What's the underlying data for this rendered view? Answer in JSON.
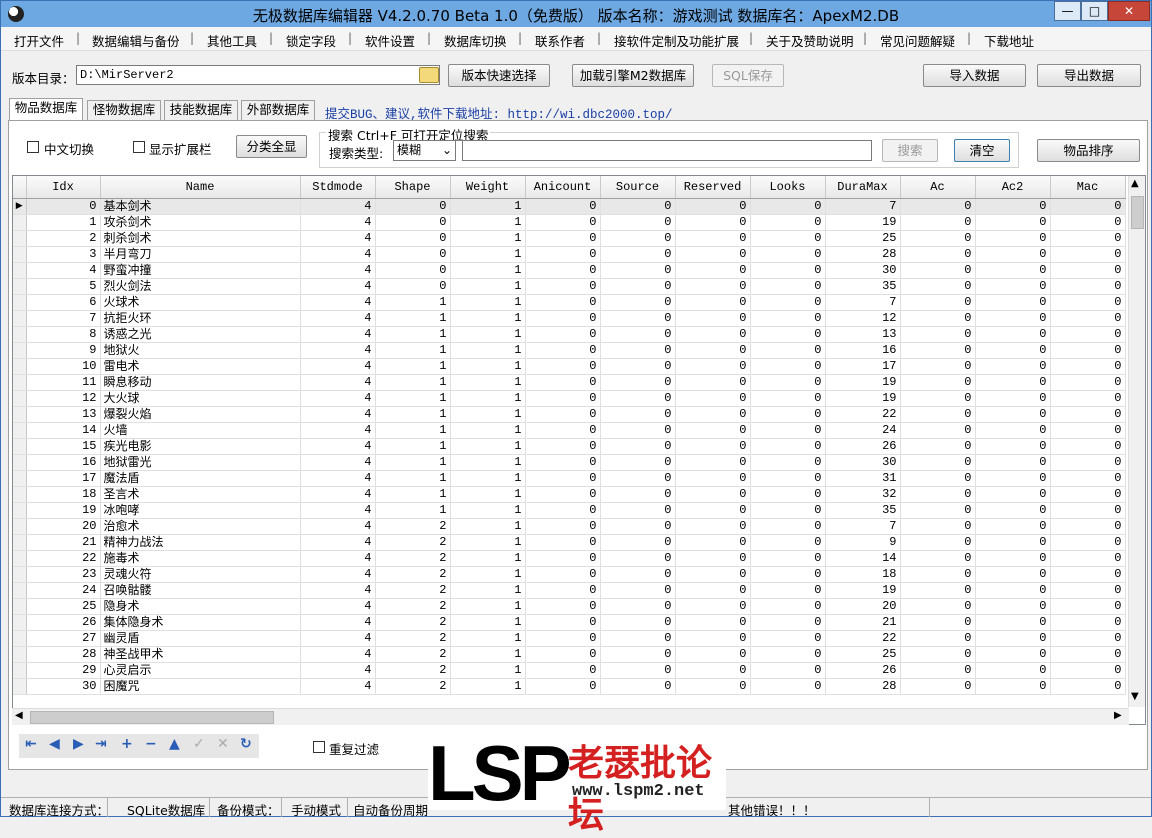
{
  "window": {
    "title": "无极数据库编辑器 V4.2.0.70   Beta 1.0（免费版）   版本名称：游戏测试    数据库名：ApexM2.DB",
    "minimize": "—",
    "maximize": "□",
    "close": "✕"
  },
  "menu": [
    "打开文件",
    "数据编辑与备份",
    "其他工具",
    "锁定字段",
    "软件设置",
    "数据库切换",
    "联系作者",
    "接软件定制及功能扩展",
    "关于及赞助说明",
    "常见问题解疑",
    "下载地址"
  ],
  "toolbar": {
    "dir_label": "版本目录：",
    "dir_value": "D:\\MirServer2",
    "quick_select": "版本快速选择",
    "load_engine": "加载引擎M2数据库",
    "sql_save": "SQL保存",
    "import": "导入数据",
    "export": "导出数据"
  },
  "tabs": [
    "物品数据库",
    "怪物数据库",
    "技能数据库",
    "外部数据库"
  ],
  "bug_link": "提交BUG、建议,软件下载地址: http://wi.dbc2000.top/",
  "search": {
    "cn_switch": "中文切换",
    "show_ext": "显示扩展栏",
    "cat_all": "分类全显",
    "hint": "搜索  Ctrl+F 可打开定位搜索",
    "type_label": "搜索类型:",
    "type_value": "模糊",
    "search_btn": "搜索",
    "clear_btn": "清空",
    "sort_btn": "物品排序"
  },
  "grid": {
    "columns": [
      "Idx",
      "Name",
      "Stdmode",
      "Shape",
      "Weight",
      "Anicount",
      "Source",
      "Reserved",
      "Looks",
      "DuraMax",
      "Ac",
      "Ac2",
      "Mac"
    ],
    "rows": [
      [
        0,
        "基本剑术",
        4,
        0,
        1,
        0,
        0,
        0,
        0,
        7,
        0,
        0,
        0
      ],
      [
        1,
        "攻杀剑术",
        4,
        0,
        1,
        0,
        0,
        0,
        0,
        19,
        0,
        0,
        0
      ],
      [
        2,
        "刺杀剑术",
        4,
        0,
        1,
        0,
        0,
        0,
        0,
        25,
        0,
        0,
        0
      ],
      [
        3,
        "半月弯刀",
        4,
        0,
        1,
        0,
        0,
        0,
        0,
        28,
        0,
        0,
        0
      ],
      [
        4,
        "野蛮冲撞",
        4,
        0,
        1,
        0,
        0,
        0,
        0,
        30,
        0,
        0,
        0
      ],
      [
        5,
        "烈火剑法",
        4,
        0,
        1,
        0,
        0,
        0,
        0,
        35,
        0,
        0,
        0
      ],
      [
        6,
        "火球术",
        4,
        1,
        1,
        0,
        0,
        0,
        0,
        7,
        0,
        0,
        0
      ],
      [
        7,
        "抗拒火环",
        4,
        1,
        1,
        0,
        0,
        0,
        0,
        12,
        0,
        0,
        0
      ],
      [
        8,
        "诱惑之光",
        4,
        1,
        1,
        0,
        0,
        0,
        0,
        13,
        0,
        0,
        0
      ],
      [
        9,
        "地狱火",
        4,
        1,
        1,
        0,
        0,
        0,
        0,
        16,
        0,
        0,
        0
      ],
      [
        10,
        "雷电术",
        4,
        1,
        1,
        0,
        0,
        0,
        0,
        17,
        0,
        0,
        0
      ],
      [
        11,
        "瞬息移动",
        4,
        1,
        1,
        0,
        0,
        0,
        0,
        19,
        0,
        0,
        0
      ],
      [
        12,
        "大火球",
        4,
        1,
        1,
        0,
        0,
        0,
        0,
        19,
        0,
        0,
        0
      ],
      [
        13,
        "爆裂火焰",
        4,
        1,
        1,
        0,
        0,
        0,
        0,
        22,
        0,
        0,
        0
      ],
      [
        14,
        "火墙",
        4,
        1,
        1,
        0,
        0,
        0,
        0,
        24,
        0,
        0,
        0
      ],
      [
        15,
        "疾光电影",
        4,
        1,
        1,
        0,
        0,
        0,
        0,
        26,
        0,
        0,
        0
      ],
      [
        16,
        "地狱雷光",
        4,
        1,
        1,
        0,
        0,
        0,
        0,
        30,
        0,
        0,
        0
      ],
      [
        17,
        "魔法盾",
        4,
        1,
        1,
        0,
        0,
        0,
        0,
        31,
        0,
        0,
        0
      ],
      [
        18,
        "圣言术",
        4,
        1,
        1,
        0,
        0,
        0,
        0,
        32,
        0,
        0,
        0
      ],
      [
        19,
        "冰咆哮",
        4,
        1,
        1,
        0,
        0,
        0,
        0,
        35,
        0,
        0,
        0
      ],
      [
        20,
        "治愈术",
        4,
        2,
        1,
        0,
        0,
        0,
        0,
        7,
        0,
        0,
        0
      ],
      [
        21,
        "精神力战法",
        4,
        2,
        1,
        0,
        0,
        0,
        0,
        9,
        0,
        0,
        0
      ],
      [
        22,
        "施毒术",
        4,
        2,
        1,
        0,
        0,
        0,
        0,
        14,
        0,
        0,
        0
      ],
      [
        23,
        "灵魂火符",
        4,
        2,
        1,
        0,
        0,
        0,
        0,
        18,
        0,
        0,
        0
      ],
      [
        24,
        "召唤骷髅",
        4,
        2,
        1,
        0,
        0,
        0,
        0,
        19,
        0,
        0,
        0
      ],
      [
        25,
        "隐身术",
        4,
        2,
        1,
        0,
        0,
        0,
        0,
        20,
        0,
        0,
        0
      ],
      [
        26,
        "集体隐身术",
        4,
        2,
        1,
        0,
        0,
        0,
        0,
        21,
        0,
        0,
        0
      ],
      [
        27,
        "幽灵盾",
        4,
        2,
        1,
        0,
        0,
        0,
        0,
        22,
        0,
        0,
        0
      ],
      [
        28,
        "神圣战甲术",
        4,
        2,
        1,
        0,
        0,
        0,
        0,
        25,
        0,
        0,
        0
      ],
      [
        29,
        "心灵启示",
        4,
        2,
        1,
        0,
        0,
        0,
        0,
        26,
        0,
        0,
        0
      ],
      [
        30,
        "困魔咒",
        4,
        2,
        1,
        0,
        0,
        0,
        0,
        28,
        0,
        0,
        0
      ]
    ]
  },
  "nav": [
    "⇤",
    "◀",
    "▶",
    "⇥",
    "+",
    "−",
    "▲",
    "✓",
    "✕",
    "↻"
  ],
  "repeat_filter": "重复过滤",
  "watermark": {
    "big": "LSP",
    "cn": "老瑟批论坛",
    "url": "www.lspm2.net"
  },
  "status": {
    "conn_label": "数据库连接方式：",
    "conn_value": "SQLite数据库",
    "backup_label": "备份模式：",
    "backup_value": "手动模式",
    "auto_backup": "自动备份周期",
    "error": "其他错误！！！"
  }
}
